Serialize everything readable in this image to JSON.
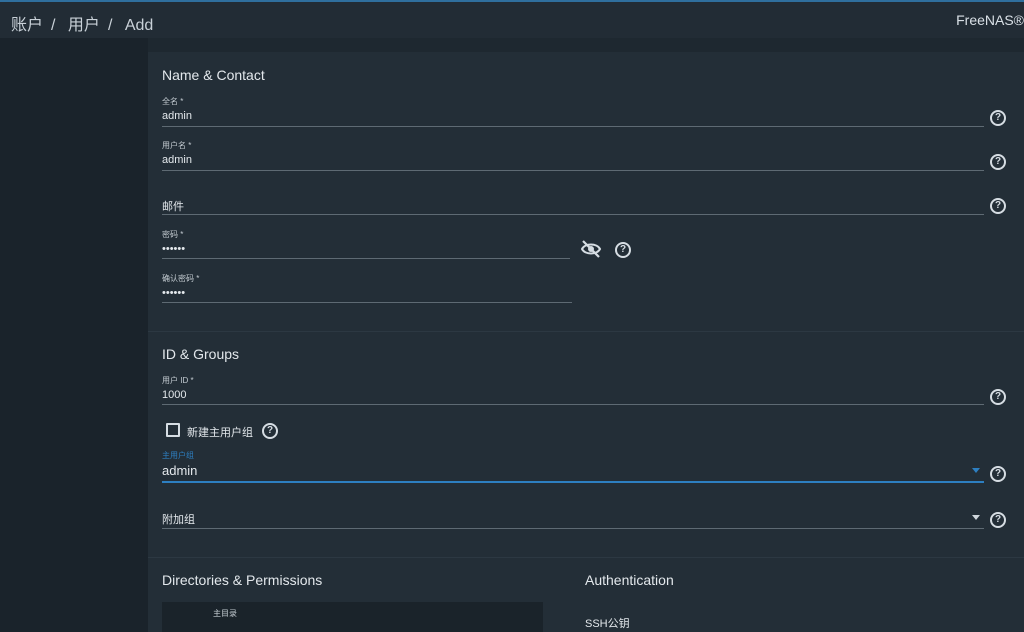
{
  "header": {
    "breadcrumbs": [
      "账户",
      "用户",
      "Add"
    ],
    "separator": "/",
    "brand": "FreeNAS®"
  },
  "sections": {
    "name_contact": "Name & Contact",
    "id_groups": "ID & Groups",
    "directories": "Directories & Permissions",
    "authentication": "Authentication"
  },
  "fields": {
    "full_name": {
      "label": "全名 *",
      "value": "admin"
    },
    "username": {
      "label": "用户名 *",
      "value": "admin"
    },
    "email": {
      "placeholder": "邮件"
    },
    "password": {
      "label": "密码 *",
      "value": "••••••"
    },
    "confirm_password": {
      "label": "确认密码 *",
      "value": "••••••"
    },
    "user_id": {
      "label": "用户 ID *",
      "value": "1000"
    },
    "new_primary_group": {
      "label": "新建主用户组",
      "checked": false
    },
    "primary_group": {
      "label": "主用户组",
      "value": "admin"
    },
    "aux_groups": {
      "placeholder": "附加组"
    },
    "home_dir": {
      "label": "主目录"
    },
    "ssh_key": {
      "label": "SSH公钥"
    }
  },
  "icons": {
    "help": "?",
    "visibility_off": "eye-off-icon"
  },
  "colors": {
    "accent": "#2d7fc1",
    "panel": "#232e37",
    "background": "#1e2830"
  }
}
